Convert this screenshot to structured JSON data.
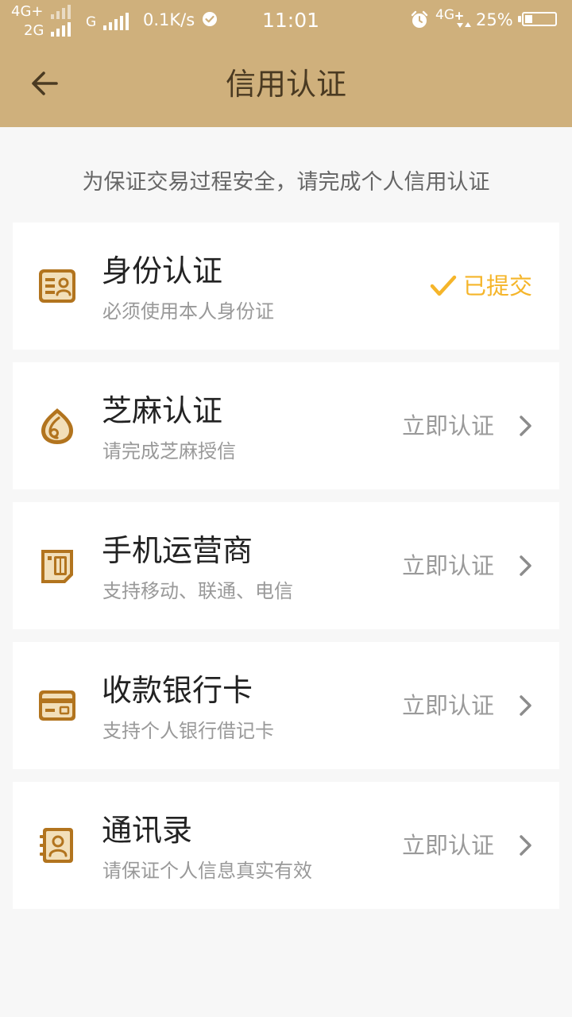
{
  "status_bar": {
    "net1": "4G+",
    "net2": "2G",
    "net_g": "G",
    "speed": "0.1K/s",
    "time": "11:01",
    "net3": "4G",
    "battery_pct": "25%",
    "battery_level": 0.25
  },
  "nav": {
    "title": "信用认证"
  },
  "notice": "为保证交易过程安全，请完成个人信用认证",
  "items": [
    {
      "title": "身份认证",
      "subtitle": "必须使用本人身份证",
      "action": "已提交",
      "icon": "id-card-icon"
    },
    {
      "title": "芝麻认证",
      "subtitle": "请完成芝麻授信",
      "action": "立即认证",
      "icon": "sesame-icon"
    },
    {
      "title": "手机运营商",
      "subtitle": "支持移动、联通、电信",
      "action": "立即认证",
      "icon": "sim-card-icon"
    },
    {
      "title": "收款银行卡",
      "subtitle": "支持个人银行借记卡",
      "action": "立即认证",
      "icon": "bank-card-icon"
    },
    {
      "title": "通讯录",
      "subtitle": "请保证个人信息真实有效",
      "action": "立即认证",
      "icon": "contacts-icon"
    }
  ],
  "colors": {
    "header_bg": "#cfb07c",
    "icon_brown": "#b2741e",
    "submitted": "#f5b52a",
    "page_bg": "#f7f7f7"
  }
}
